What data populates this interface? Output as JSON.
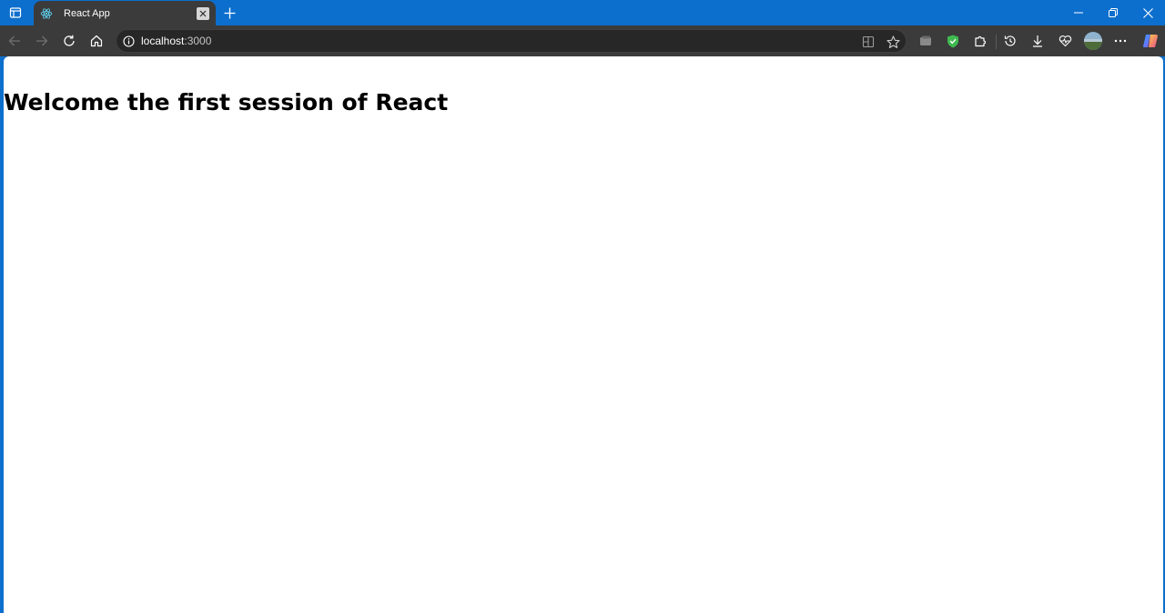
{
  "browser": {
    "tab": {
      "title": "React App",
      "favicon": "react-logo-icon"
    },
    "address_bar": {
      "host": "localhost",
      "port": ":3000"
    },
    "icons": {
      "tab_actions": "tab-actions-icon",
      "new_tab": "plus-icon",
      "back": "back-arrow-icon",
      "forward": "forward-arrow-icon",
      "refresh": "refresh-icon",
      "home": "home-icon",
      "site_info": "info-icon",
      "split_screen": "split-screen-icon",
      "favorite": "star-icon",
      "extensions": [
        "wallet-icon",
        "shield-icon",
        "puzzle-icon"
      ],
      "history": "history-icon",
      "downloads": "download-icon",
      "health": "heart-pulse-icon",
      "profile": "avatar",
      "more": "more-icon",
      "copilot": "copilot-icon"
    },
    "colors": {
      "titlebar": "#0d6fcd",
      "toolbar": "#3b3b3b",
      "omnibox": "#272727"
    }
  },
  "page": {
    "heading": "Welcome the first session of React"
  }
}
